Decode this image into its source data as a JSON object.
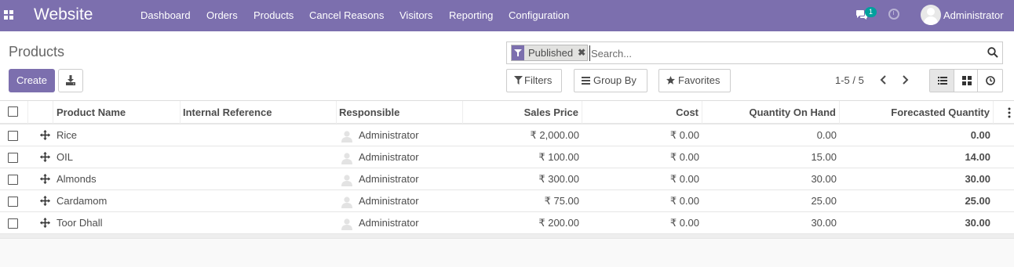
{
  "navbar": {
    "brand": "Website",
    "menu": [
      "Dashboard",
      "Orders",
      "Products",
      "Cancel Reasons",
      "Visitors",
      "Reporting",
      "Configuration"
    ],
    "chat_count": "1",
    "user_name": "Administrator",
    "background_color": "#7c6fae"
  },
  "control_panel": {
    "breadcrumb": "Products",
    "create_label": "Create",
    "search": {
      "facet_label": "Published",
      "placeholder": "Search..."
    },
    "filters_label": "Filters",
    "group_by_label": "Group By",
    "favorites_label": "Favorites",
    "pager": "1-5 / 5"
  },
  "table": {
    "headers": [
      "Product Name",
      "Internal Reference",
      "Responsible",
      "Sales Price",
      "Cost",
      "Quantity On Hand",
      "Forecasted Quantity"
    ],
    "rows": [
      {
        "name": "Rice",
        "ref": "",
        "responsible": "Administrator",
        "price": "₹ 2,000.00",
        "cost": "₹ 0.00",
        "on_hand": "0.00",
        "forecast": "0.00"
      },
      {
        "name": "OIL",
        "ref": "",
        "responsible": "Administrator",
        "price": "₹ 100.00",
        "cost": "₹ 0.00",
        "on_hand": "15.00",
        "forecast": "14.00"
      },
      {
        "name": "Almonds",
        "ref": "",
        "responsible": "Administrator",
        "price": "₹ 300.00",
        "cost": "₹ 0.00",
        "on_hand": "30.00",
        "forecast": "30.00"
      },
      {
        "name": "Cardamom",
        "ref": "",
        "responsible": "Administrator",
        "price": "₹ 75.00",
        "cost": "₹ 0.00",
        "on_hand": "25.00",
        "forecast": "25.00"
      },
      {
        "name": "Toor Dhall",
        "ref": "",
        "responsible": "Administrator",
        "price": "₹ 200.00",
        "cost": "₹ 0.00",
        "on_hand": "30.00",
        "forecast": "30.00"
      }
    ]
  }
}
